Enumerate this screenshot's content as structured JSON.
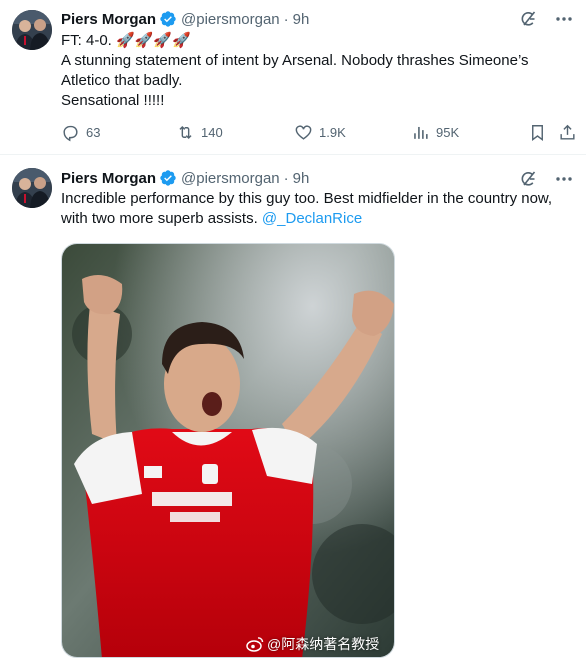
{
  "tweets": [
    {
      "author_name": "Piers Morgan",
      "handle": "@piersmorgan",
      "separator": "·",
      "time": "9h",
      "lines": [
        "FT: 4-0. 🚀🚀🚀🚀",
        "A stunning statement of intent by Arsenal. Nobody thrashes Simeone’s",
        "Atletico that badly.",
        "Sensational !!!!!"
      ],
      "stats": {
        "replies": "63",
        "retweets": "140",
        "likes": "1.9K",
        "views": "95K"
      }
    },
    {
      "author_name": "Piers Morgan",
      "handle": "@piersmorgan",
      "separator": "·",
      "time": "9h",
      "lines": [
        "Incredible performance by this guy too. Best midfielder in the country now,",
        "with two more superb assists."
      ],
      "mention": "@_DeclanRice",
      "watermark": "@阿森纳著名教授"
    }
  ],
  "colors": {
    "accent": "#1d9bf0",
    "text_primary": "#0f1419",
    "text_secondary": "#536471",
    "jersey_red": "#db0007",
    "sleeve_white": "#ffffff"
  },
  "icons": [
    "verified-badge-icon",
    "grok-icon",
    "more-icon",
    "reply-icon",
    "retweet-icon",
    "like-icon",
    "views-icon",
    "bookmark-icon",
    "share-icon",
    "weibo-icon"
  ]
}
